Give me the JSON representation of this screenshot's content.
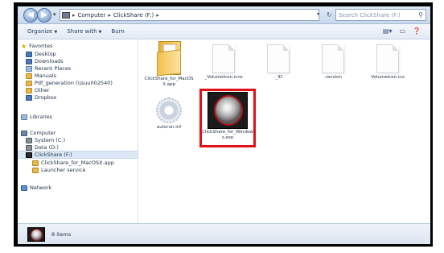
{
  "address_bar": {
    "path": [
      "Computer",
      "ClickShare (F:)"
    ],
    "search_placeholder": "Search ClickShare (F:)"
  },
  "toolbar": {
    "organize_label": "Organize",
    "share_label": "Share with",
    "burn_label": "Burn"
  },
  "navigation": {
    "favorites_header": "Favorites",
    "favorites": [
      "Desktop",
      "Downloads",
      "Recent Places",
      "Manuals",
      "Pdf_generation (\\\\suu002540)",
      "Other",
      "Dropbox"
    ],
    "libraries_header": "Libraries",
    "computer_header": "Computer",
    "drives": [
      "System (C:)",
      "Data (D:)",
      "ClickShare (F:)"
    ],
    "drive_children": [
      "ClickShare_for_MacOSX.app",
      "Launcher service"
    ],
    "network_header": "Network"
  },
  "files": [
    {
      "name": "ClickShare_for_MacOSX.app",
      "icon": "folder-icon"
    },
    {
      "name": "_VolumeIcon.icns",
      "icon": "document-icon"
    },
    {
      "name": "._ID",
      "icon": "document-icon"
    },
    {
      "name": ".version",
      "icon": "document-icon"
    },
    {
      "name": "VolumeIcon.ico",
      "icon": "document-icon"
    },
    {
      "name": "autorun.inf",
      "icon": "settings-file-icon"
    },
    {
      "name": "ClickShare_for_Windows.exe",
      "icon": "clickshare-app-icon"
    }
  ],
  "details_pane": {
    "item_count": "8 items"
  },
  "colors": {
    "highlight": "#e0101a",
    "frame": "#000000"
  }
}
